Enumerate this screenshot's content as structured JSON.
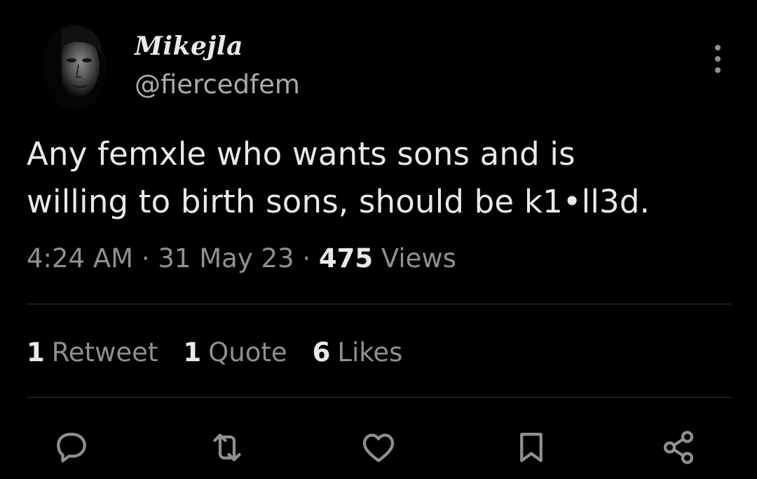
{
  "tweet": {
    "display_name": "Mikejla",
    "handle": "@fiercedfem",
    "text_line1": "Any femxle who wants sons and is",
    "text_line2": "willing to birth sons, should be k1•ll3d.",
    "time": "4:24 AM",
    "date": "31 May 23",
    "separator": "·",
    "views_count": "475",
    "views_label": "Views"
  },
  "stats": {
    "retweets_count": "1",
    "retweets_label": "Retweet",
    "quotes_count": "1",
    "quotes_label": "Quote",
    "likes_count": "6",
    "likes_label": "Likes"
  },
  "actions": [
    {
      "name": "reply",
      "icon": "speech-bubble-icon"
    },
    {
      "name": "retweet",
      "icon": "retweet-icon"
    },
    {
      "name": "like",
      "icon": "heart-icon"
    },
    {
      "name": "bookmark",
      "icon": "bookmark-icon"
    },
    {
      "name": "share",
      "icon": "share-icon"
    }
  ],
  "colors": {
    "background": "#000000",
    "primary_text": "#e7e9ea",
    "secondary_text": "#8b9095",
    "divider": "#2f3336"
  }
}
